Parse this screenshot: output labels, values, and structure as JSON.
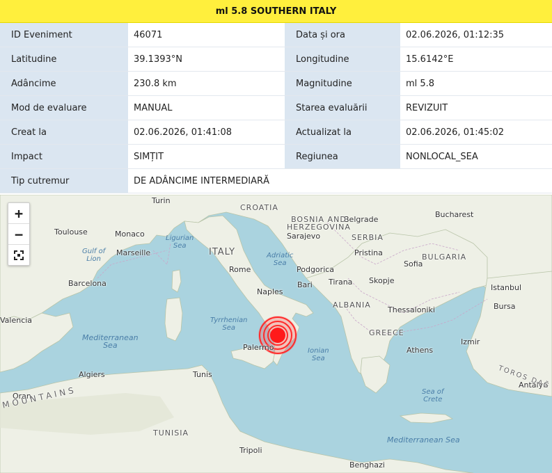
{
  "title": "ml 5.8 SOUTHERN ITALY",
  "rows": [
    {
      "l1": "ID Eveniment",
      "v1": "46071",
      "l2": "Data și ora",
      "v2": "02.06.2026, 01:12:35"
    },
    {
      "l1": "Latitudine",
      "v1": "39.1393°N",
      "l2": "Longitudine",
      "v2": "15.6142°E"
    },
    {
      "l1": "Adâncime",
      "v1": "230.8 km",
      "l2": "Magnitudine",
      "v2": "ml 5.8"
    },
    {
      "l1": "Mod de evaluare",
      "v1": "MANUAL",
      "l2": "Starea evaluării",
      "v2": "REVIZUIT"
    },
    {
      "l1": "Creat la",
      "v1": "02.06.2026, 01:41:08",
      "l2": "Actualizat la",
      "v2": "02.06.2026, 01:45:02"
    },
    {
      "l1": "Impact",
      "v1": "SIMȚIT",
      "l2": "Regiunea",
      "v2": "NONLOCAL_SEA"
    },
    {
      "l1": "Tip cutremur",
      "v1": "DE ADÂNCIME INTERMEDIARĂ"
    }
  ],
  "controls": {
    "zoom_in": "+",
    "zoom_out": "−"
  },
  "map": {
    "cities": {
      "turin": "Turin",
      "toulouse": "Toulouse",
      "monaco": "Monaco",
      "marseille": "Marseille",
      "barcelona": "Barcelona",
      "valencia": "Valencia",
      "rome": "Rome",
      "naples": "Naples",
      "bari": "Bari",
      "palermo": "Palermo",
      "algiers": "Algiers",
      "tunis": "Tunis",
      "oran": "Oran",
      "tripoli": "Tripoli",
      "benghazi": "Benghazi",
      "sarajevo": "Sarajevo",
      "belgrade": "Belgrade",
      "podgorica": "Podgorica",
      "tirana": "Tirana",
      "pristina": "Pristina",
      "skopje": "Skopje",
      "sofia": "Sofia",
      "bucharest": "Bucharest",
      "thessaloniki": "Thessaloniki",
      "athens": "Athens",
      "istanbul": "Istanbul",
      "bursa": "Bursa",
      "izmir": "Izmir",
      "antalya": "Antalya"
    },
    "countries": {
      "italy": "ITALY",
      "croatia": "CROATIA",
      "bih": "BOSNIA AND\nHERZEGOVINA",
      "serbia": "SERBIA",
      "bulgaria": "BULGARIA",
      "albania": "ALBANIA",
      "greece": "GREECE",
      "tunisia": "TUNISIA"
    },
    "seas": {
      "ligurian": "Ligurian\nSea",
      "adriatic": "Adriatic\nSea",
      "lion": "Gulf of\nLion",
      "tyrrhenian": "Tyrrhenian\nSea",
      "ionian": "Ionian\nSea",
      "crete": "Sea of\nCrete",
      "med_west": "Mediterranean\nSea",
      "med_east": "Mediterranean Sea"
    },
    "mountains": "MOUNTAINS",
    "toros": "TOROS DAĞ"
  }
}
